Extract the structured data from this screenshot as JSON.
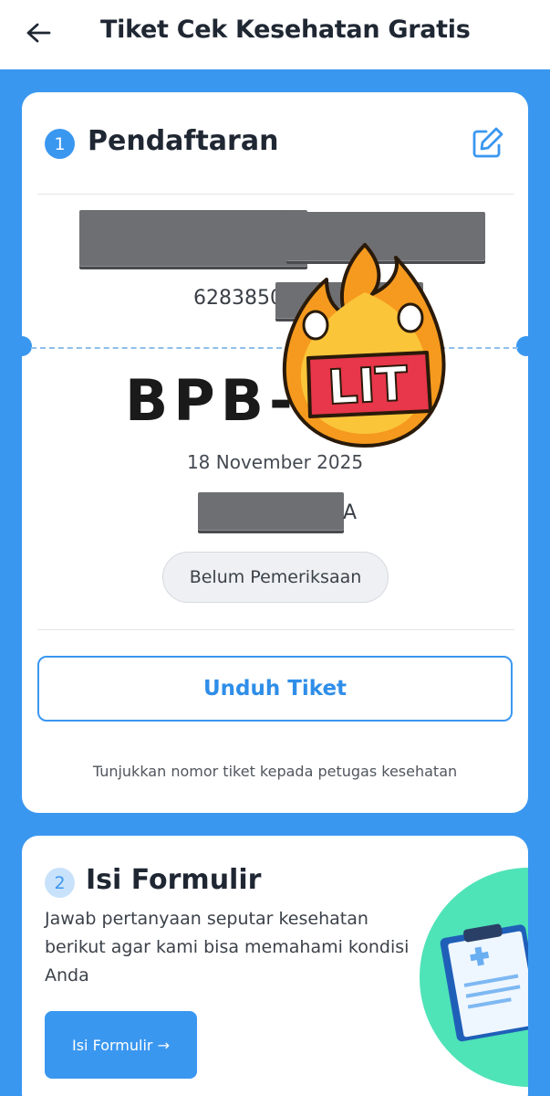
{
  "header": {
    "title": "Tiket Cek Kesehatan Gratis",
    "back_icon": "arrow-left-icon"
  },
  "registration": {
    "step_number": "1",
    "title": "Pendaftaran",
    "edit_icon": "edit-icon",
    "phone_visible": "6283850",
    "ticket_prefix": "BPB-",
    "date": "18 November 2025",
    "location_suffix": "A",
    "status": "Belum Pemeriksaan",
    "download_label": "Unduh Tiket",
    "hint": "Tunjukkan nomor tiket kepada petugas kesehatan"
  },
  "sticker": {
    "text": "LIT"
  },
  "form": {
    "step_number": "2",
    "title": "Isi Formulir",
    "description": "Jawab pertanyaan seputar kesehatan berikut agar kami bisa memahami kondisi Anda",
    "button_label": "Isi Formulir →",
    "illustration_icon": "clipboard-medical-icon"
  },
  "colors": {
    "primary": "#3a97f0",
    "accent_green": "#4fe3b8",
    "sticker_orange": "#f59a1e",
    "sticker_red": "#e8364a"
  }
}
